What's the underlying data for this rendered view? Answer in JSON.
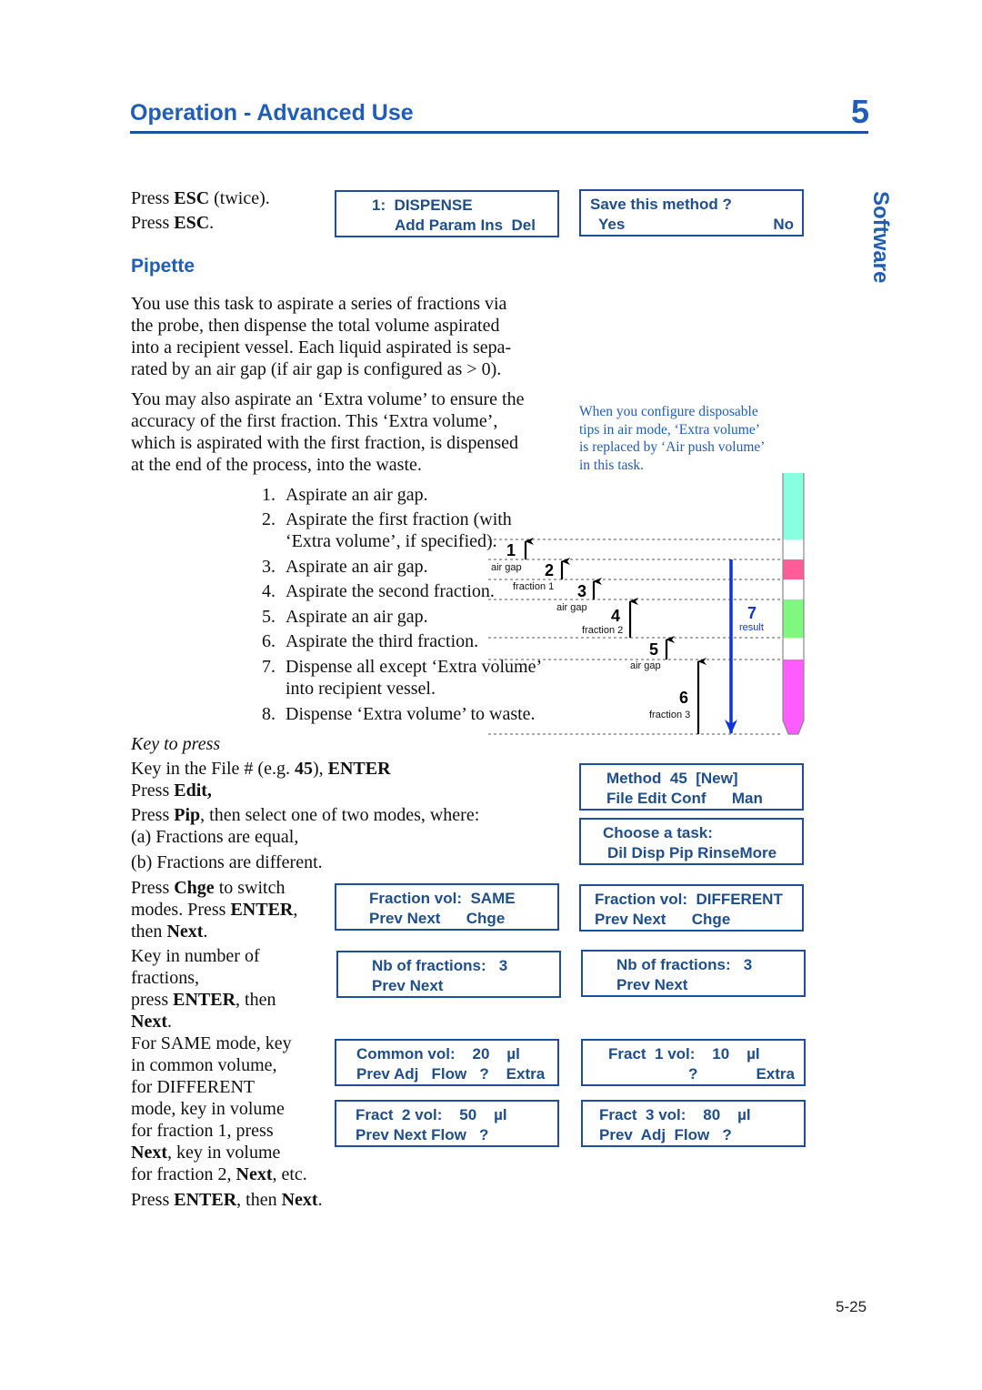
{
  "header": {
    "title": "Operation - Advanced Use",
    "chapter": "5",
    "side_tab": "Software",
    "page_number": "5-25"
  },
  "colors": {
    "accent": "#1f5db8",
    "lcd_text": "#1f4e8c",
    "result_arrow": "#1034d8",
    "tube_cyan": "#88ffe0",
    "tube_pink": "#ff5c99",
    "tube_green": "#80f880",
    "tube_magenta": "#ff5cff"
  },
  "intro": {
    "press1": [
      "Press ",
      "ESC",
      " (twice)."
    ],
    "press2": [
      "Press ",
      "ESC",
      "."
    ]
  },
  "section": {
    "title": "Pipette"
  },
  "para1": [
    "You use this task to aspirate a series of fractions via",
    "the probe, then dispense the total volume aspirated",
    "into a recipient vessel. Each liquid aspirated is sepa-",
    "rated by an air gap (if air gap is configured as > 0)."
  ],
  "para2": [
    "You may also aspirate an ‘Extra volume’ to ensure the",
    "accuracy of the first fraction. This ‘Extra volume’,",
    "which is aspirated with the first fraction, is dispensed",
    "at the end of the process, into the waste."
  ],
  "steps": [
    {
      "n": "1.",
      "lines": [
        "Aspirate an air gap."
      ]
    },
    {
      "n": "2.",
      "lines": [
        "Aspirate the first fraction (with",
        "‘Extra volume’, if specified)."
      ]
    },
    {
      "n": "3.",
      "lines": [
        "Aspirate an air gap."
      ]
    },
    {
      "n": "4.",
      "lines": [
        "Aspirate the second fraction."
      ]
    },
    {
      "n": "5.",
      "lines": [
        "Aspirate an air gap."
      ]
    },
    {
      "n": "6.",
      "lines": [
        "Aspirate the third fraction."
      ]
    },
    {
      "n": "7.",
      "lines": [
        "Dispense all except ‘Extra volume’",
        "into recipient vessel."
      ]
    },
    {
      "n": "8.",
      "lines": [
        "Dispense ‘Extra volume’ to waste."
      ]
    }
  ],
  "note": "When you configure disposable\ntips in air mode, ‘Extra volume’\nis replaced by ‘Air push volume’\nin this task.",
  "keys": {
    "title": "Key to press",
    "k1": [
      "Key in the File # (e.g. ",
      "45",
      "), ",
      "ENTER"
    ],
    "k2": [
      "Press ",
      "Edit,"
    ],
    "k3": [
      "Press ",
      "Pip",
      ", then select one of two modes, where:"
    ],
    "k4": "(a) Fractions are equal,",
    "k5": "(b) Fractions are different.",
    "k6a": [
      "Press ",
      "Chge",
      " to switch"
    ],
    "k6b": [
      "modes. Press ",
      "ENTER",
      ","
    ],
    "k6c": [
      "then ",
      "Next",
      "."
    ],
    "k7a": "Key in number of",
    "k7b": "fractions,",
    "k7c": [
      "press ",
      "ENTER",
      ", then"
    ],
    "k7d": [
      "Next",
      "."
    ],
    "k8a": "For SAME mode, key",
    "k8b": "in common volume,",
    "k8c": "for DIFFERENT",
    "k8d": "mode, key in volume",
    "k8e": "for fraction 1, press",
    "k8f": [
      "Next",
      ", key in volume"
    ],
    "k8g": [
      "for fraction 2, ",
      "Next",
      ", etc."
    ],
    "k9": [
      "Press ",
      "ENTER",
      ", then ",
      "Next",
      "."
    ]
  },
  "lcd": {
    "dispense": [
      "1:  DISPENSE",
      "Add Param Ins  Del"
    ],
    "save": [
      "Save this method ?",
      "Yes",
      "No"
    ],
    "method": [
      "Method  45  [New]",
      "File Edit Conf      Man"
    ],
    "choose": [
      "Choose a task:",
      "Dil Disp Pip RinseMore"
    ],
    "same": [
      "Fraction vol:  SAME",
      "Prev Next      Chge"
    ],
    "different": [
      "Fraction vol:  DIFFERENT",
      "Prev Next      Chge"
    ],
    "nb_a": [
      "Nb of fractions:   3",
      "Prev Next"
    ],
    "nb_b": [
      "Nb of fractions:   3",
      "Prev Next"
    ],
    "common": [
      "Common vol:    20    µl",
      "Prev Adj   Flow   ?    Extra"
    ],
    "fract1": [
      "Fract  1 vol:    10    µl",
      "?",
      "Extra"
    ],
    "fract2": [
      "Fract  2 vol:    50    µl",
      "Prev Next Flow   ?"
    ],
    "fract3": [
      "Fract  3 vol:    80    µl",
      "Prev  Adj  Flow   ?"
    ]
  },
  "diagram": {
    "steps": [
      "1",
      "2",
      "3",
      "4",
      "5",
      "6",
      "7"
    ],
    "labels": [
      "air gap",
      "fraction 1",
      "air gap",
      "fraction 2",
      "air gap",
      "fraction 3",
      "result"
    ]
  }
}
